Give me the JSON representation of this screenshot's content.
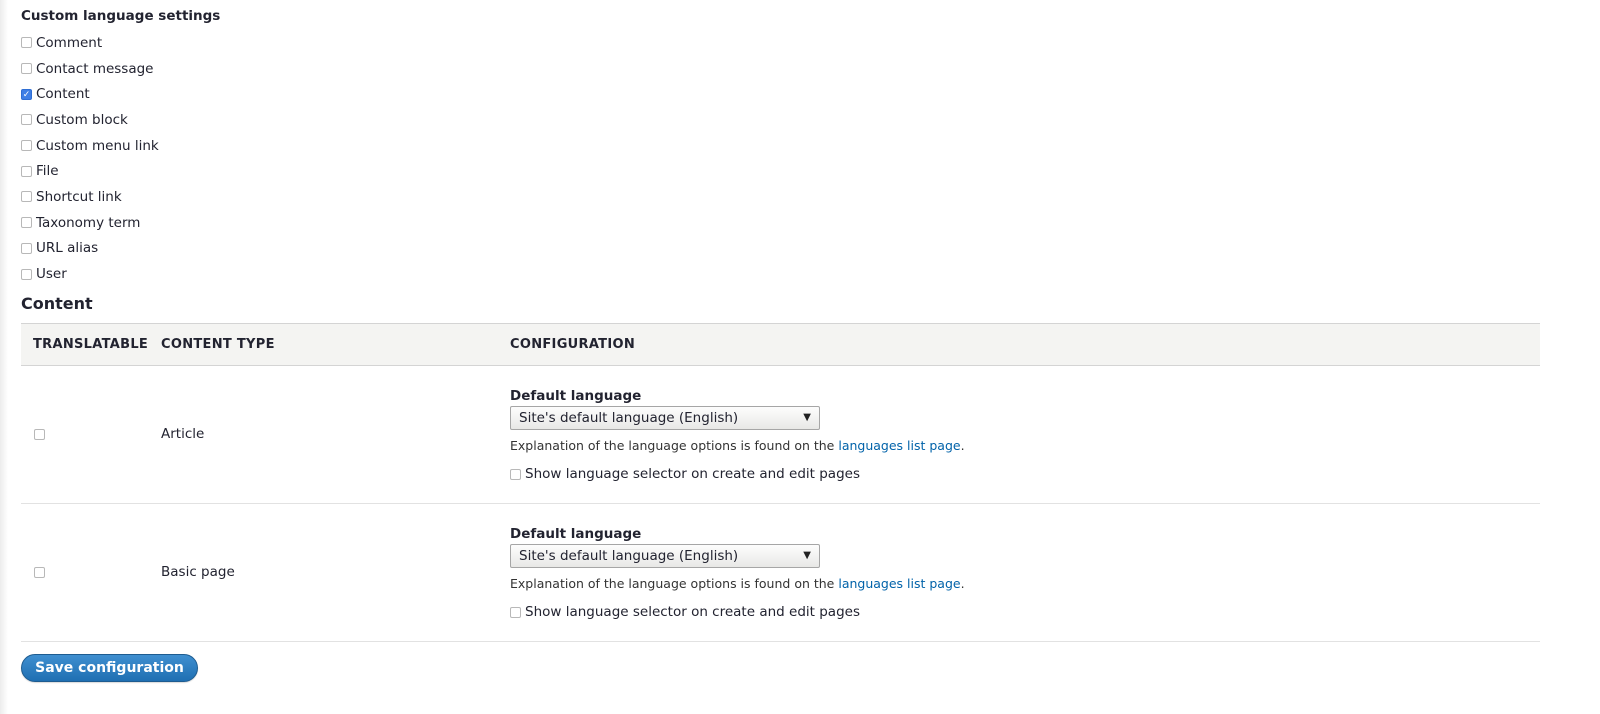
{
  "custom_language_settings": {
    "title": "Custom language settings",
    "items": [
      {
        "label": "Comment",
        "checked": false
      },
      {
        "label": "Contact message",
        "checked": false
      },
      {
        "label": "Content",
        "checked": true
      },
      {
        "label": "Custom block",
        "checked": false
      },
      {
        "label": "Custom menu link",
        "checked": false
      },
      {
        "label": "File",
        "checked": false
      },
      {
        "label": "Shortcut link",
        "checked": false
      },
      {
        "label": "Taxonomy term",
        "checked": false
      },
      {
        "label": "URL alias",
        "checked": false
      },
      {
        "label": "User",
        "checked": false
      }
    ]
  },
  "content_section": {
    "heading": "Content",
    "columns": [
      "TRANSLATABLE",
      "CONTENT TYPE",
      "CONFIGURATION"
    ],
    "rows": [
      {
        "content_type": "Article",
        "translatable": false,
        "default_language_label": "Default language",
        "default_language_value": "Site's default language (English)",
        "description_prefix": "Explanation of the language options is found on the ",
        "description_link": "languages list page",
        "description_suffix": ".",
        "show_selector_label": "Show language selector on create and edit pages",
        "show_selector_checked": false
      },
      {
        "content_type": "Basic page",
        "translatable": false,
        "default_language_label": "Default language",
        "default_language_value": "Site's default language (English)",
        "description_prefix": "Explanation of the language options is found on the ",
        "description_link": "languages list page",
        "description_suffix": ".",
        "show_selector_label": "Show language selector on create and edit pages",
        "show_selector_checked": false
      }
    ]
  },
  "actions": {
    "save_label": "Save configuration"
  },
  "colors": {
    "accent": "#1f6fb2",
    "checkbox_checked": "#3f7fe5",
    "link": "#0062a9",
    "table_header_bg": "#f4f4f2"
  }
}
